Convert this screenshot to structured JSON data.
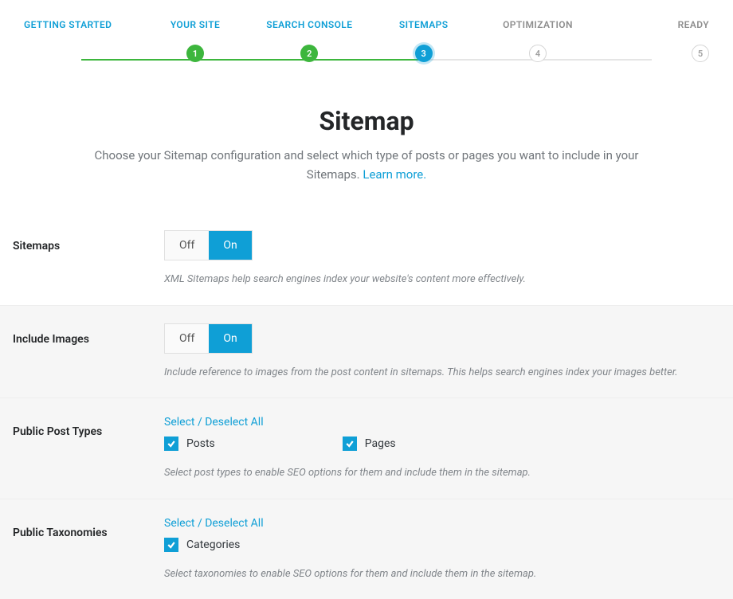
{
  "wizard": {
    "steps": [
      {
        "label": "GETTING STARTED",
        "num": "",
        "state": "start"
      },
      {
        "label": "YOUR SITE",
        "num": "1",
        "state": "done"
      },
      {
        "label": "SEARCH CONSOLE",
        "num": "2",
        "state": "done"
      },
      {
        "label": "SITEMAPS",
        "num": "3",
        "state": "active"
      },
      {
        "label": "OPTIMIZATION",
        "num": "4",
        "state": "pending"
      },
      {
        "label": "READY",
        "num": "5",
        "state": "pending"
      }
    ]
  },
  "header": {
    "title": "Sitemap",
    "desc_pre": "Choose your Sitemap configuration and select which type of posts or pages you want to include in your Sitemaps. ",
    "learn_more": "Learn more."
  },
  "sections": {
    "sitemaps": {
      "label": "Sitemaps",
      "off": "Off",
      "on": "On",
      "help": "XML Sitemaps help search engines index your website's content more effectively."
    },
    "images": {
      "label": "Include Images",
      "off": "Off",
      "on": "On",
      "help": "Include reference to images from the post content in sitemaps. This helps search engines index your images better."
    },
    "post_types": {
      "label": "Public Post Types",
      "select_all": "Select / Deselect All",
      "items": [
        {
          "label": "Posts"
        },
        {
          "label": "Pages"
        }
      ],
      "help": "Select post types to enable SEO options for them and include them in the sitemap."
    },
    "taxonomies": {
      "label": "Public Taxonomies",
      "select_all": "Select / Deselect All",
      "items": [
        {
          "label": "Categories"
        }
      ],
      "help": "Select taxonomies to enable SEO options for them and include them in the sitemap."
    }
  }
}
